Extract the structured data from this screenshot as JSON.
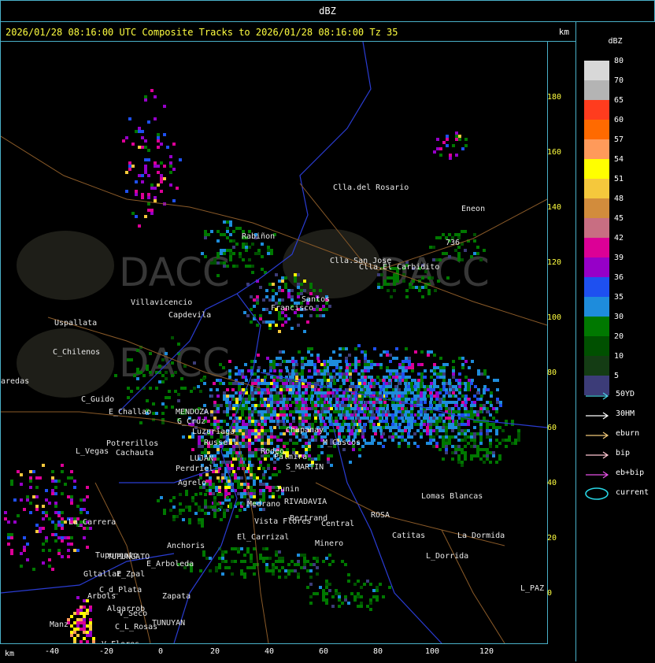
{
  "window": {
    "title": "dBZ"
  },
  "header": {
    "text": "2026/01/28 08:16:00 UTC Composite Tracks to 2026/01/28 08:16:00 Tz 35",
    "km_label": "km"
  },
  "axes": {
    "x_unit": "km",
    "x_ticks": [
      "-40",
      "-20",
      "0",
      "20",
      "40",
      "60",
      "80",
      "100",
      "120"
    ],
    "y_ticks": [
      "180",
      "160",
      "140",
      "120",
      "100",
      "80",
      "60",
      "40",
      "20",
      "0"
    ]
  },
  "legend": {
    "title": "dBZ",
    "scale": [
      {
        "label": "80",
        "color": "#d8d8d8"
      },
      {
        "label": "70",
        "color": "#b4b4b4"
      },
      {
        "label": "65",
        "color": "#ff3c1e"
      },
      {
        "label": "60",
        "color": "#ff6a00"
      },
      {
        "label": "57",
        "color": "#ff9a5a"
      },
      {
        "label": "54",
        "color": "#ffff00"
      },
      {
        "label": "51",
        "color": "#f5c83c"
      },
      {
        "label": "48",
        "color": "#d28c3c"
      },
      {
        "label": "45",
        "color": "#c86e82"
      },
      {
        "label": "42",
        "color": "#dc0096"
      },
      {
        "label": "39",
        "color": "#9600c8"
      },
      {
        "label": "36",
        "color": "#1e50f0"
      },
      {
        "label": "35",
        "color": "#1e8cdc"
      },
      {
        "label": "30",
        "color": "#007800"
      },
      {
        "label": "20",
        "color": "#005000"
      },
      {
        "label": "10",
        "color": "#143c14"
      },
      {
        "label": "5",
        "color": "#3c3c78"
      }
    ],
    "tracks": [
      {
        "label": "50YD",
        "color": "#4ad2e6"
      },
      {
        "label": "30HM",
        "color": "#ffffff"
      },
      {
        "label": "eburn",
        "color": "#f0c878"
      },
      {
        "label": "bip",
        "color": "#ffc8d2"
      },
      {
        "label": "eb+bip",
        "color": "#e650e6"
      }
    ],
    "current_label": "current",
    "current_color": "#28d7e6"
  },
  "map": {
    "watermark": "DACC",
    "places": [
      {
        "name": "Clla.del Rosario"
      },
      {
        "name": "Eneon"
      },
      {
        "name": "736"
      },
      {
        "name": "Rabiñon"
      },
      {
        "name": "Clla.San Jose"
      },
      {
        "name": "Clla.El Carbidito"
      },
      {
        "name": "Villavicencio"
      },
      {
        "name": "Capdevila"
      },
      {
        "name": "Francisco"
      },
      {
        "name": "Santos"
      },
      {
        "name": "Uspallata"
      },
      {
        "name": "C_Chilenos"
      },
      {
        "name": "aredas"
      },
      {
        "name": "C_Guido"
      },
      {
        "name": "E_Challao"
      },
      {
        "name": "MENDOZA"
      },
      {
        "name": "G_Cruz"
      },
      {
        "name": "Luzuriaga"
      },
      {
        "name": "Russell"
      },
      {
        "name": "Chapanay"
      },
      {
        "name": "M_Cascos"
      },
      {
        "name": "Potrerillos"
      },
      {
        "name": "L_Vegas"
      },
      {
        "name": "Cachauta"
      },
      {
        "name": "LUJAN"
      },
      {
        "name": "Perdriel"
      },
      {
        "name": "Rodeo"
      },
      {
        "name": "Palmira"
      },
      {
        "name": "S_MARTIN"
      },
      {
        "name": "Agrelo"
      },
      {
        "name": "RIVADAVIA"
      },
      {
        "name": "Lomas Blancas"
      },
      {
        "name": "La_Carrera"
      },
      {
        "name": "Central"
      },
      {
        "name": "ROSA"
      },
      {
        "name": "Catitas"
      },
      {
        "name": "Minero"
      },
      {
        "name": "Anchoris"
      },
      {
        "name": "El_Carrizal"
      },
      {
        "name": "TUPUNGATO"
      },
      {
        "name": "L_Dorrida"
      },
      {
        "name": "E_Arboleda"
      },
      {
        "name": "Gltallar"
      },
      {
        "name": "E_Zpal"
      },
      {
        "name": "C_d_Plata"
      },
      {
        "name": "Zapata"
      },
      {
        "name": "Arbols"
      },
      {
        "name": "Algarrob"
      },
      {
        "name": "V_Seco"
      },
      {
        "name": "TUNUYAN"
      },
      {
        "name": "C_L_Rosas"
      },
      {
        "name": "Manz"
      },
      {
        "name": "V_Flores"
      },
      {
        "name": "L_PAZ"
      },
      {
        "name": "Tupungato"
      },
      {
        "name": "Junin"
      },
      {
        "name": "Medrano"
      },
      {
        "name": "Vista Flores"
      },
      {
        "name": "Bertrand"
      },
      {
        "name": "La Dormida"
      }
    ]
  }
}
